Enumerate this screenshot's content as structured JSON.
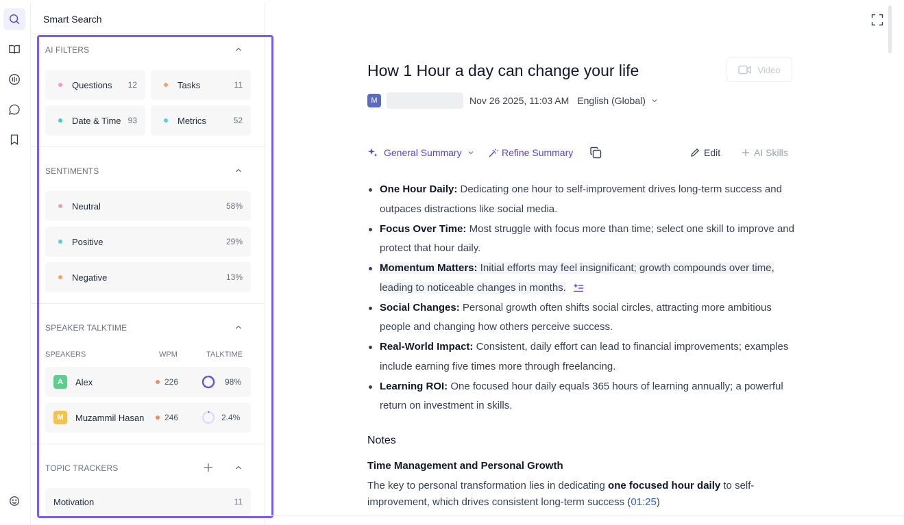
{
  "panel": {
    "title": "Smart Search",
    "ai_filters": {
      "heading": "AI FILTERS",
      "items": [
        {
          "label": "Questions",
          "count": "12",
          "color": "#f49ac8"
        },
        {
          "label": "Tasks",
          "count": "11",
          "color": "#f5a26a"
        },
        {
          "label": "Date & Time",
          "count": "93",
          "color": "#3fd0c4"
        },
        {
          "label": "Metrics",
          "count": "52",
          "color": "#4fd3e0"
        }
      ]
    },
    "sentiments": {
      "heading": "SENTIMENTS",
      "items": [
        {
          "label": "Neutral",
          "value": "58%",
          "color": "#f49ac8"
        },
        {
          "label": "Positive",
          "value": "29%",
          "color": "#4fd3e0"
        },
        {
          "label": "Negative",
          "value": "13%",
          "color": "#f5a26a"
        }
      ]
    },
    "talktime": {
      "heading": "SPEAKER TALKTIME",
      "col_speakers": "SPEAKERS",
      "col_wpm": "WPM",
      "col_talktime": "TALKTIME",
      "speakers": [
        {
          "initial": "A",
          "name": "Alex",
          "wpm": "226",
          "talktime": "98%",
          "talktime_fraction": 0.98,
          "avatar_color": "#5ccf8f"
        },
        {
          "initial": "M",
          "name": "Muzammil Hasan",
          "wpm": "246",
          "talktime": "2.4%",
          "talktime_fraction": 0.024,
          "avatar_color": "#f7c14a"
        }
      ]
    },
    "topic_trackers": {
      "heading": "TOPIC TRACKERS",
      "items": [
        {
          "label": "Motivation",
          "count": "11"
        }
      ]
    }
  },
  "doc": {
    "title": "How 1 Hour a day can change your life",
    "video_label": "Video",
    "author_initial": "M",
    "datetime": "Nov 26 2025, 11:03 AM",
    "language": "English (Global)"
  },
  "toolbar": {
    "summary_type": "General Summary",
    "refine": "Refine Summary",
    "edit": "Edit",
    "ai_skills": "AI Skills"
  },
  "summary": [
    {
      "head": "One Hour Daily:",
      "text": " Dedicating one hour to self-improvement drives long-term success and outpaces distractions like social media."
    },
    {
      "head": "Focus Over Time:",
      "text": " Most struggle with focus more than time; select one skill to improve and protect that hour daily."
    },
    {
      "head": "Momentum Matters:",
      "text": " Initial efforts may feel insignificant; growth compounds over time, leading to noticeable changes in months."
    },
    {
      "head": "Social Changes:",
      "text": " Personal growth often shifts social circles, attracting more ambitious people and changing how others perceive success."
    },
    {
      "head": "Real-World Impact:",
      "text": " Consistent, daily effort can lead to financial improvements; examples include earning five times more through freelancing."
    },
    {
      "head": "Learning ROI:",
      "text": " One focused hour daily equals 365 hours of learning annually; a powerful return on investment in skills."
    }
  ],
  "notes": {
    "heading": "Notes",
    "subheading": "Time Management and Personal Growth",
    "body_pre": "The key to personal transformation lies in dedicating ",
    "body_bold": "one focused hour daily",
    "body_post": " to self-improvement, which drives consistent long-term success (",
    "timestamp": "01:25",
    "body_end": ")"
  },
  "colors": {
    "accent": "#5b3fd6",
    "highlight_border": "#7b5cf0",
    "link": "#2563eb"
  },
  "icons": {
    "rail": [
      "search-icon",
      "book-icon",
      "audio-wave-icon",
      "chat-icon",
      "bookmark-icon",
      "smiley-icon"
    ],
    "toolbar": [
      "sparkle-icon",
      "magic-wand-icon",
      "copy-icon",
      "pencil-icon",
      "plus-icon"
    ]
  }
}
